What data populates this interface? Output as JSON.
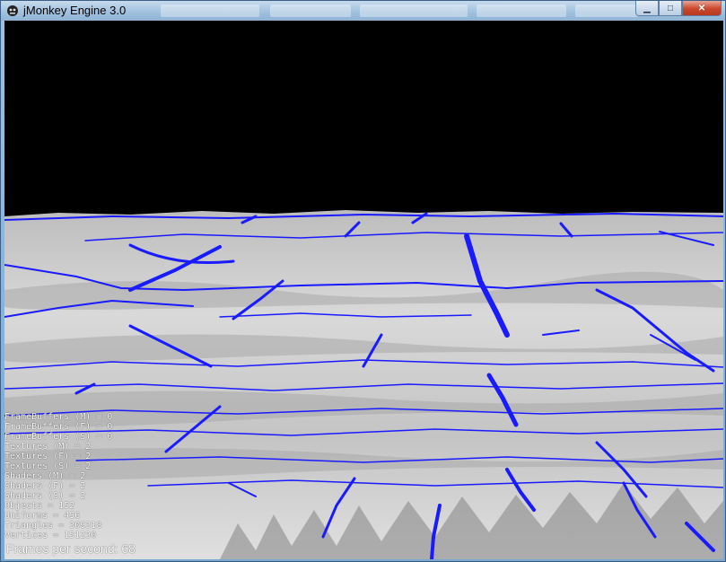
{
  "window": {
    "title": "jMonkey Engine 3.0",
    "controls": {
      "minimize_icon": "minimize-icon",
      "maximize_icon": "maximize-icon",
      "close_icon": "close-icon"
    }
  },
  "stats": [
    "FrameBuffers (M) = 0",
    "FrameBuffers (F) = 0",
    "FrameBuffers (S) = 0",
    "Textures (M) = 2",
    "Textures (F) = 2",
    "Textures (S) = 2",
    "Shaders (M) = 2",
    "Shaders (F) = 2",
    "Shaders (S) = 2",
    "Objects = 152",
    "Uniforms = 456",
    "Triangles = 309318",
    "Vertices = 151230"
  ],
  "fps_label": "Frames per second: 68",
  "colors": {
    "sky": "#000000",
    "terrain": "#c8c8c8",
    "contour": "#1a1aff"
  }
}
